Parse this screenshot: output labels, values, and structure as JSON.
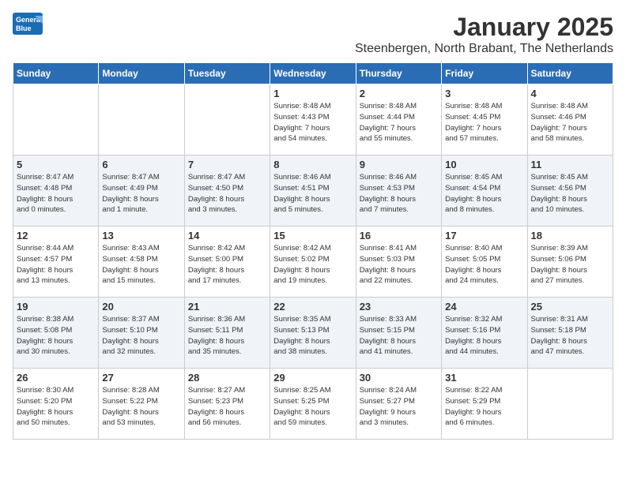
{
  "logo": {
    "general": "General",
    "blue": "Blue"
  },
  "header": {
    "month": "January 2025",
    "location": "Steenbergen, North Brabant, The Netherlands"
  },
  "weekdays": [
    "Sunday",
    "Monday",
    "Tuesday",
    "Wednesday",
    "Thursday",
    "Friday",
    "Saturday"
  ],
  "weeks": [
    [
      {
        "day": "",
        "info": ""
      },
      {
        "day": "",
        "info": ""
      },
      {
        "day": "",
        "info": ""
      },
      {
        "day": "1",
        "info": "Sunrise: 8:48 AM\nSunset: 4:43 PM\nDaylight: 7 hours\nand 54 minutes."
      },
      {
        "day": "2",
        "info": "Sunrise: 8:48 AM\nSunset: 4:44 PM\nDaylight: 7 hours\nand 55 minutes."
      },
      {
        "day": "3",
        "info": "Sunrise: 8:48 AM\nSunset: 4:45 PM\nDaylight: 7 hours\nand 57 minutes."
      },
      {
        "day": "4",
        "info": "Sunrise: 8:48 AM\nSunset: 4:46 PM\nDaylight: 7 hours\nand 58 minutes."
      }
    ],
    [
      {
        "day": "5",
        "info": "Sunrise: 8:47 AM\nSunset: 4:48 PM\nDaylight: 8 hours\nand 0 minutes."
      },
      {
        "day": "6",
        "info": "Sunrise: 8:47 AM\nSunset: 4:49 PM\nDaylight: 8 hours\nand 1 minute."
      },
      {
        "day": "7",
        "info": "Sunrise: 8:47 AM\nSunset: 4:50 PM\nDaylight: 8 hours\nand 3 minutes."
      },
      {
        "day": "8",
        "info": "Sunrise: 8:46 AM\nSunset: 4:51 PM\nDaylight: 8 hours\nand 5 minutes."
      },
      {
        "day": "9",
        "info": "Sunrise: 8:46 AM\nSunset: 4:53 PM\nDaylight: 8 hours\nand 7 minutes."
      },
      {
        "day": "10",
        "info": "Sunrise: 8:45 AM\nSunset: 4:54 PM\nDaylight: 8 hours\nand 8 minutes."
      },
      {
        "day": "11",
        "info": "Sunrise: 8:45 AM\nSunset: 4:56 PM\nDaylight: 8 hours\nand 10 minutes."
      }
    ],
    [
      {
        "day": "12",
        "info": "Sunrise: 8:44 AM\nSunset: 4:57 PM\nDaylight: 8 hours\nand 13 minutes."
      },
      {
        "day": "13",
        "info": "Sunrise: 8:43 AM\nSunset: 4:58 PM\nDaylight: 8 hours\nand 15 minutes."
      },
      {
        "day": "14",
        "info": "Sunrise: 8:42 AM\nSunset: 5:00 PM\nDaylight: 8 hours\nand 17 minutes."
      },
      {
        "day": "15",
        "info": "Sunrise: 8:42 AM\nSunset: 5:02 PM\nDaylight: 8 hours\nand 19 minutes."
      },
      {
        "day": "16",
        "info": "Sunrise: 8:41 AM\nSunset: 5:03 PM\nDaylight: 8 hours\nand 22 minutes."
      },
      {
        "day": "17",
        "info": "Sunrise: 8:40 AM\nSunset: 5:05 PM\nDaylight: 8 hours\nand 24 minutes."
      },
      {
        "day": "18",
        "info": "Sunrise: 8:39 AM\nSunset: 5:06 PM\nDaylight: 8 hours\nand 27 minutes."
      }
    ],
    [
      {
        "day": "19",
        "info": "Sunrise: 8:38 AM\nSunset: 5:08 PM\nDaylight: 8 hours\nand 30 minutes."
      },
      {
        "day": "20",
        "info": "Sunrise: 8:37 AM\nSunset: 5:10 PM\nDaylight: 8 hours\nand 32 minutes."
      },
      {
        "day": "21",
        "info": "Sunrise: 8:36 AM\nSunset: 5:11 PM\nDaylight: 8 hours\nand 35 minutes."
      },
      {
        "day": "22",
        "info": "Sunrise: 8:35 AM\nSunset: 5:13 PM\nDaylight: 8 hours\nand 38 minutes."
      },
      {
        "day": "23",
        "info": "Sunrise: 8:33 AM\nSunset: 5:15 PM\nDaylight: 8 hours\nand 41 minutes."
      },
      {
        "day": "24",
        "info": "Sunrise: 8:32 AM\nSunset: 5:16 PM\nDaylight: 8 hours\nand 44 minutes."
      },
      {
        "day": "25",
        "info": "Sunrise: 8:31 AM\nSunset: 5:18 PM\nDaylight: 8 hours\nand 47 minutes."
      }
    ],
    [
      {
        "day": "26",
        "info": "Sunrise: 8:30 AM\nSunset: 5:20 PM\nDaylight: 8 hours\nand 50 minutes."
      },
      {
        "day": "27",
        "info": "Sunrise: 8:28 AM\nSunset: 5:22 PM\nDaylight: 8 hours\nand 53 minutes."
      },
      {
        "day": "28",
        "info": "Sunrise: 8:27 AM\nSunset: 5:23 PM\nDaylight: 8 hours\nand 56 minutes."
      },
      {
        "day": "29",
        "info": "Sunrise: 8:25 AM\nSunset: 5:25 PM\nDaylight: 8 hours\nand 59 minutes."
      },
      {
        "day": "30",
        "info": "Sunrise: 8:24 AM\nSunset: 5:27 PM\nDaylight: 9 hours\nand 3 minutes."
      },
      {
        "day": "31",
        "info": "Sunrise: 8:22 AM\nSunset: 5:29 PM\nDaylight: 9 hours\nand 6 minutes."
      },
      {
        "day": "",
        "info": ""
      }
    ]
  ]
}
